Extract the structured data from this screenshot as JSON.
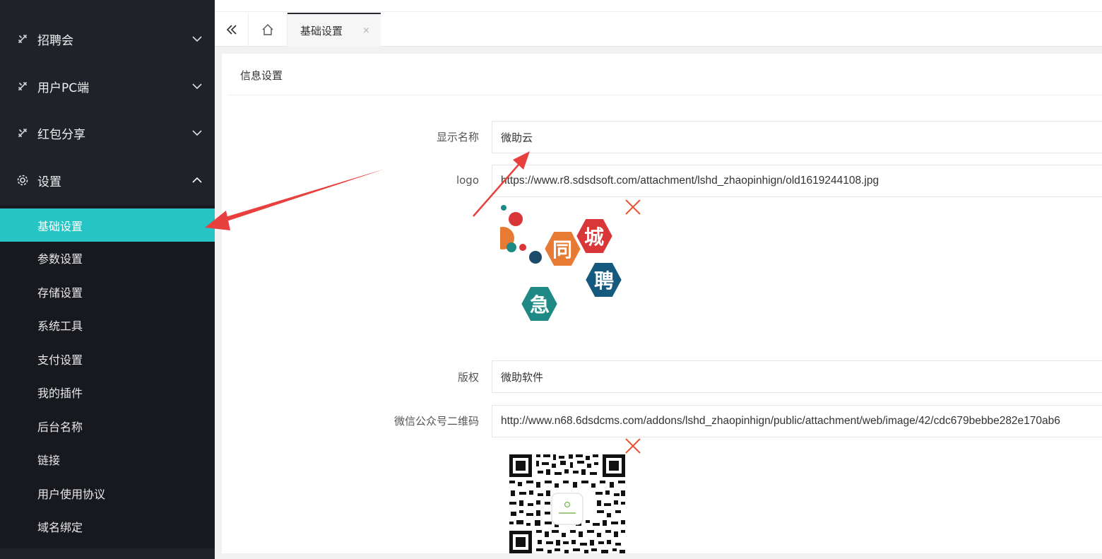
{
  "sidebar": {
    "groups": [
      {
        "label": "招聘会",
        "icon": "tools-icon",
        "expanded": false
      },
      {
        "label": "用户PC端",
        "icon": "tools-icon",
        "expanded": false
      },
      {
        "label": "红包分享",
        "icon": "tools-icon",
        "expanded": false
      },
      {
        "label": "设置",
        "icon": "gear-icon",
        "expanded": true
      }
    ],
    "sub_items": [
      {
        "label": "基础设置",
        "active": true
      },
      {
        "label": "参数设置"
      },
      {
        "label": "存储设置"
      },
      {
        "label": "系统工具"
      },
      {
        "label": "支付设置"
      },
      {
        "label": "我的插件"
      },
      {
        "label": "后台名称"
      },
      {
        "label": "链接"
      },
      {
        "label": "用户使用协议"
      },
      {
        "label": "域名绑定"
      }
    ],
    "accent_color": "#27c4c6"
  },
  "tabs": [
    {
      "label": "基础设置",
      "close": "×",
      "active": true
    }
  ],
  "card": {
    "title": "信息设置",
    "fields": {
      "display_name": {
        "label": "显示名称",
        "value": "微助云"
      },
      "logo": {
        "label": "logo",
        "value": "https://www.r8.sdsdsoft.com/attachment/lshd_zhaopinhign/old1619244108.jpg"
      },
      "copyright": {
        "label": "版权",
        "value": "微助软件"
      },
      "wechat_qr": {
        "label": "微信公众号二维码",
        "value": "http://www.n68.6dsdcms.com/addons/lshd_zhaopinhign/public/attachment/web/image/42/cdc679bebbe282e170ab6"
      }
    }
  },
  "logo_image": {
    "chars": [
      "城",
      "同",
      "聘",
      "急"
    ]
  },
  "annotation_color": "#e8403f"
}
